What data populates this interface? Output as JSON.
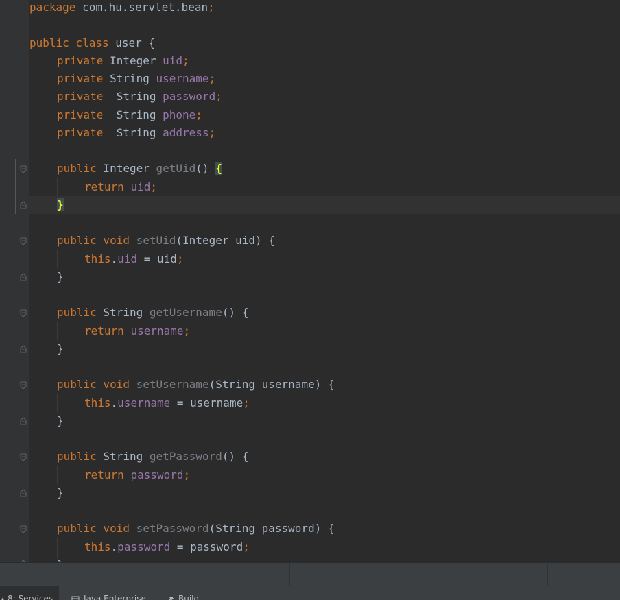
{
  "editor": {
    "lines": {
      "l1": {
        "a": "package",
        "b": " com.hu.servlet.bean",
        "c": ";"
      },
      "l3": {
        "a": "public class",
        "b": " user {"
      },
      "l4": {
        "a": "private",
        "b": " Integer ",
        "c": "uid",
        "d": ";"
      },
      "l5": {
        "a": "private",
        "b": " String ",
        "c": "username",
        "d": ";"
      },
      "l6": {
        "a": "private",
        "b": "  String ",
        "c": "password",
        "d": ";"
      },
      "l7": {
        "a": "private",
        "b": "  String ",
        "c": "phone",
        "d": ";"
      },
      "l8": {
        "a": "private",
        "b": "  String ",
        "c": "address",
        "d": ";"
      },
      "l10": {
        "a": "public",
        "b": " Integer ",
        "c": "getUid",
        "d": "() ",
        "e": "{"
      },
      "l11": {
        "a": "return",
        "b": " ",
        "c": "uid",
        "d": ";"
      },
      "l12": {
        "a": "}"
      },
      "l14": {
        "a": "public void",
        "b": " ",
        "c": "setUid",
        "d": "(Integer uid) {"
      },
      "l15": {
        "a": "this",
        "b": ".",
        "c": "uid",
        "d": " = uid",
        "e": ";"
      },
      "l16": {
        "a": "}"
      },
      "l18": {
        "a": "public",
        "b": " String ",
        "c": "getUsername",
        "d": "() {"
      },
      "l19": {
        "a": "return",
        "b": " ",
        "c": "username",
        "d": ";"
      },
      "l20": {
        "a": "}"
      },
      "l22": {
        "a": "public void",
        "b": " ",
        "c": "setUsername",
        "d": "(String username) {"
      },
      "l23": {
        "a": "this",
        "b": ".",
        "c": "username",
        "d": " = username",
        "e": ";"
      },
      "l24": {
        "a": "}"
      },
      "l26": {
        "a": "public",
        "b": " String ",
        "c": "getPassword",
        "d": "() {"
      },
      "l27": {
        "a": "return",
        "b": " ",
        "c": "password",
        "d": ";"
      },
      "l28": {
        "a": "}"
      },
      "l30": {
        "a": "public void",
        "b": " ",
        "c": "setPassword",
        "d": "(String password) {"
      },
      "l31": {
        "a": "this",
        "b": ".",
        "c": "password",
        "d": " = password",
        "e": ";"
      },
      "l32": {
        "a": "}"
      }
    }
  },
  "tool_window_bar": {
    "tabs": [
      {
        "label": "8: Services",
        "icon": "services-icon"
      },
      {
        "label": "Java Enterprise",
        "icon": "java-enterprise-icon"
      },
      {
        "label": "Build",
        "icon": "hammer-icon"
      }
    ]
  },
  "colors": {
    "background": "#2b2b2b",
    "keyword": "#cc7832",
    "field": "#9876aa",
    "text": "#a9b7c6",
    "brace_highlight": "#ffef28"
  }
}
